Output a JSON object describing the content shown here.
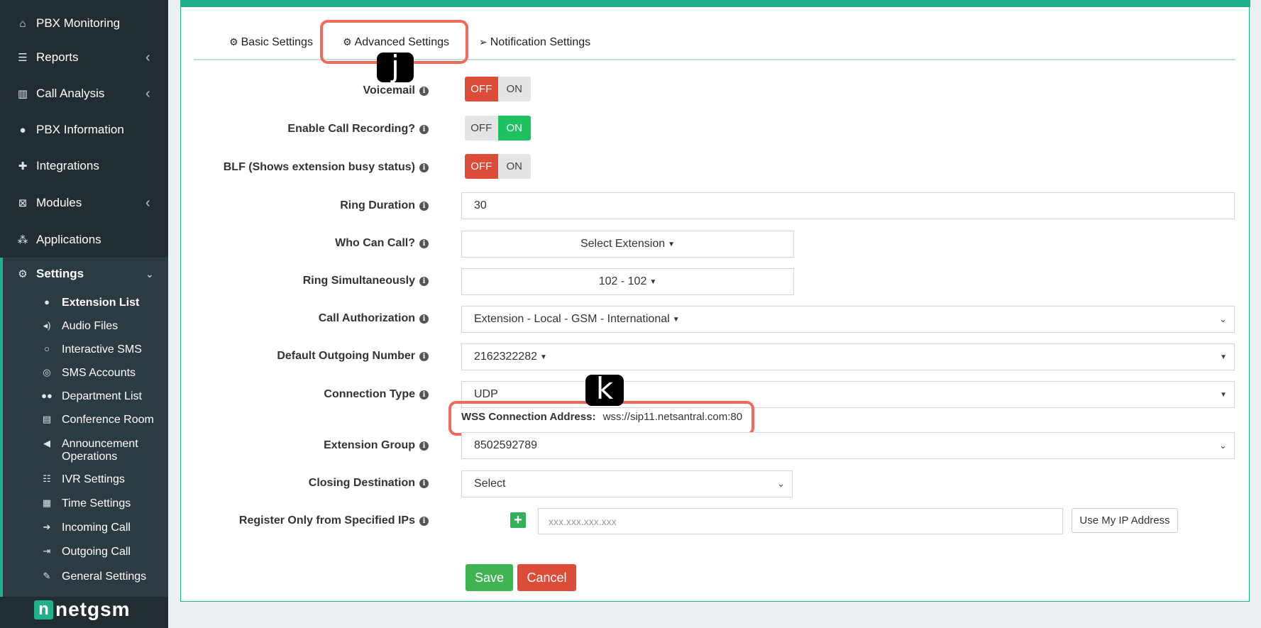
{
  "sidebar": {
    "items": [
      {
        "label": "PBX Monitoring",
        "icon": "home-icon"
      },
      {
        "label": "Reports",
        "icon": "list-icon"
      },
      {
        "label": "Call Analysis",
        "icon": "bar-chart-icon"
      },
      {
        "label": "PBX Information",
        "icon": "info-icon"
      },
      {
        "label": "Integrations",
        "icon": "puzzle-icon"
      },
      {
        "label": "Modules",
        "icon": "modules-icon"
      },
      {
        "label": "Applications",
        "icon": "apps-icon"
      },
      {
        "label": "Settings",
        "icon": "gear-icon"
      }
    ],
    "settings_subitems": [
      {
        "label": "Extension List",
        "icon": "user-icon"
      },
      {
        "label": "Audio Files",
        "icon": "volume-icon"
      },
      {
        "label": "Interactive SMS",
        "icon": "chat-icon"
      },
      {
        "label": "SMS Accounts",
        "icon": "chat-bubbles-icon"
      },
      {
        "label": "Department List",
        "icon": "users-icon"
      },
      {
        "label": "Conference Room",
        "icon": "conference-icon"
      },
      {
        "label": "Announcement Operations",
        "icon": "bullhorn-icon"
      },
      {
        "label": "IVR Settings",
        "icon": "list-ol-icon"
      },
      {
        "label": "Time Settings",
        "icon": "calendar-icon"
      },
      {
        "label": "Incoming Call",
        "icon": "sign-in-icon"
      },
      {
        "label": "Outgoing Call",
        "icon": "sign-out-icon"
      },
      {
        "label": "General Settings",
        "icon": "wrench-icon"
      }
    ],
    "logo": {
      "n": "n",
      "text": "netgsm"
    }
  },
  "tabs": {
    "basic": "Basic Settings",
    "advanced": "Advanced Settings",
    "notification": "Notification Settings"
  },
  "markers": {
    "j": "j",
    "k": "k"
  },
  "form": {
    "voicemail": {
      "label": "Voicemail",
      "off": "OFF",
      "on": "ON",
      "state": "OFF"
    },
    "call_recording": {
      "label": "Enable Call Recording?",
      "off": "OFF",
      "on": "ON",
      "state": "ON"
    },
    "blf": {
      "label": "BLF (Shows extension busy status)",
      "off": "OFF",
      "on": "ON",
      "state": "OFF"
    },
    "ring_duration": {
      "label": "Ring Duration",
      "value": "30"
    },
    "who_can_call": {
      "label": "Who Can Call?",
      "value": "Select Extension"
    },
    "ring_simultaneously": {
      "label": "Ring Simultaneously",
      "value": "102 - 102"
    },
    "call_authorization": {
      "label": "Call Authorization",
      "value": "Extension - Local - GSM - International"
    },
    "default_outgoing": {
      "label": "Default Outgoing Number",
      "value": "2162322282"
    },
    "connection_type": {
      "label": "Connection Type",
      "value": "UDP"
    },
    "wss": {
      "label": "WSS Connection Address:",
      "value": "wss://sip11.netsantral.com:80"
    },
    "extension_group": {
      "label": "Extension Group",
      "value": "8502592789"
    },
    "closing_destination": {
      "label": "Closing Destination",
      "value": "Select"
    },
    "register_ips": {
      "label": "Register Only from Specified IPs",
      "placeholder": "xxx.xxx.xxx.xxx",
      "use_my_ip": "Use My IP Address"
    }
  },
  "buttons": {
    "save": "Save",
    "cancel": "Cancel"
  },
  "colors": {
    "accent": "#1fb28a",
    "sidebar": "#222d32",
    "danger": "#dd4b39",
    "success": "#1ec15f",
    "callout": "#f06a5a"
  }
}
